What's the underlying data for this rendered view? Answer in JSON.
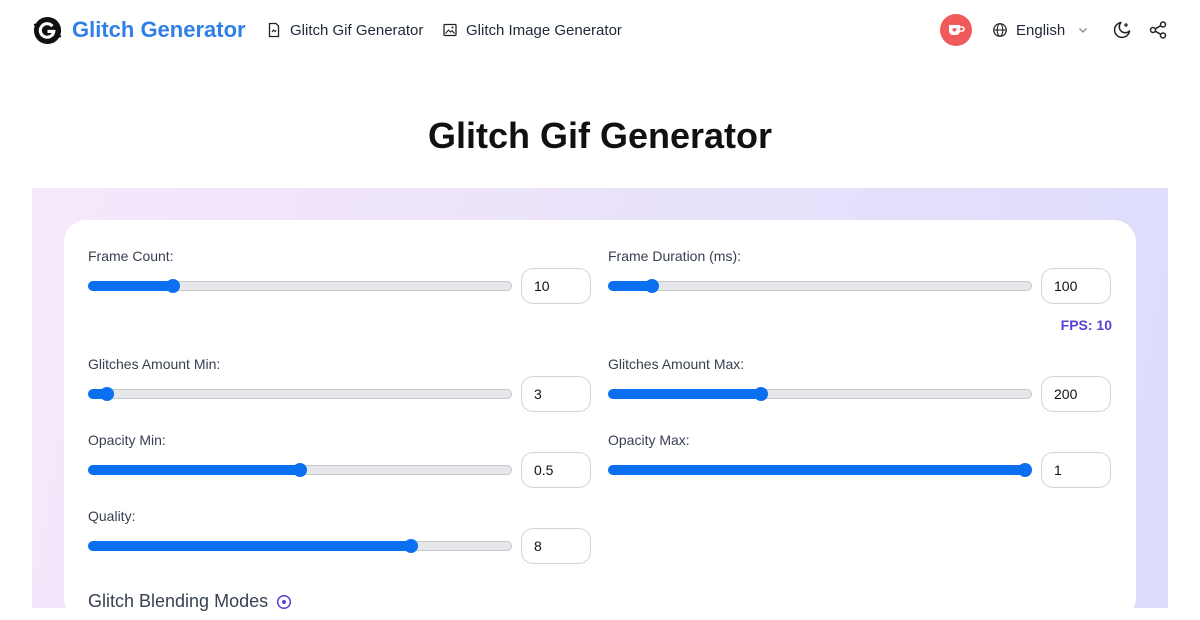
{
  "header": {
    "brand": "Glitch Generator",
    "nav": [
      {
        "label": "Glitch Gif Generator",
        "icon": "file-gif-icon"
      },
      {
        "label": "Glitch Image Generator",
        "icon": "image-icon"
      }
    ],
    "support_icon": "ko-fi-cup-icon",
    "language": "English",
    "theme_icon": "moon-stars-icon",
    "share_icon": "share-icon"
  },
  "page_title": "Glitch Gif Generator",
  "controls": {
    "frame_count": {
      "label": "Frame Count:",
      "value": "10",
      "fraction": 0.19
    },
    "frame_duration": {
      "label": "Frame Duration (ms):",
      "value": "100",
      "fraction": 0.09
    },
    "fps": "FPS: 10",
    "glitches_min": {
      "label": "Glitches Amount Min:",
      "value": "3",
      "fraction": 0.03
    },
    "glitches_max": {
      "label": "Glitches Amount Max:",
      "value": "200",
      "fraction": 0.355
    },
    "opacity_min": {
      "label": "Opacity Min:",
      "value": "0.5",
      "fraction": 0.5
    },
    "opacity_max": {
      "label": "Opacity Max:",
      "value": "1",
      "fraction": 1.0
    },
    "quality": {
      "label": "Quality:",
      "value": "8",
      "fraction": 0.77
    }
  },
  "blending": {
    "title": "Glitch Blending Modes",
    "icon": "help-circle-icon"
  },
  "colors": {
    "brand": "#2f7fe6",
    "slider": "#0b6ff2",
    "fps": "#5b3fd6",
    "kofi": "#f05a5a"
  }
}
